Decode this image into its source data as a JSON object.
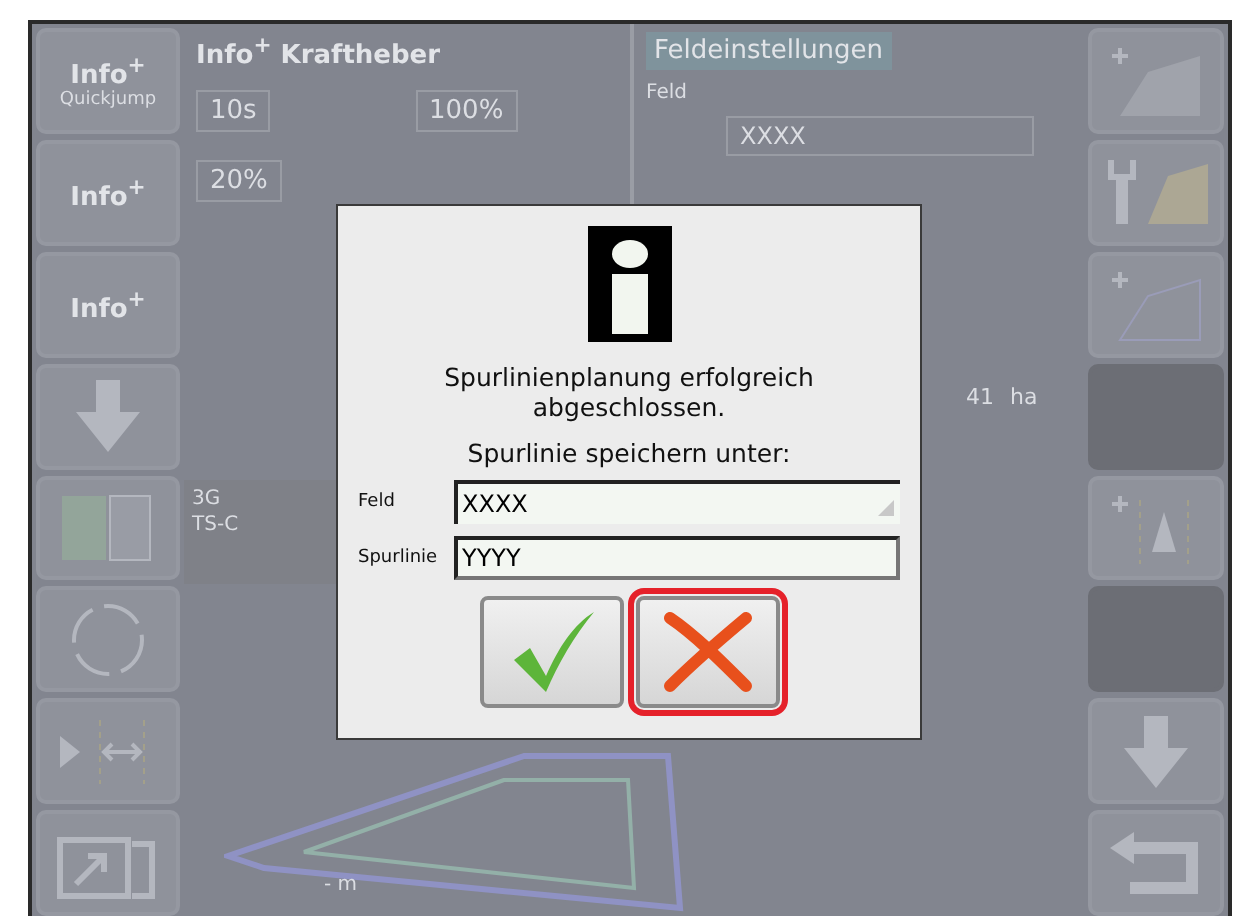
{
  "background": {
    "left_buttons": [
      {
        "kind": "info",
        "label": "Info$^{+}$",
        "caption": "Quickjump"
      },
      {
        "kind": "info",
        "label": "Info$^{+}$"
      },
      {
        "kind": "info",
        "label": "Info$^{+}$"
      },
      {
        "kind": "down"
      },
      {
        "kind": "bars"
      },
      {
        "kind": "ring"
      },
      {
        "kind": "guide"
      },
      {
        "kind": "export"
      }
    ],
    "hitch_panel": {
      "title": "Info$^{+}$ Kraftheber",
      "values": [
        "10s",
        "100%",
        "20%"
      ]
    },
    "field_panel": {
      "title": "Feldeinstellungen",
      "label": "Feld",
      "value": "XXXX",
      "area": "41",
      "unit": "ha"
    },
    "status": {
      "network": "3G",
      "receiver": "TS-C"
    },
    "map": {
      "distance": "- m"
    },
    "right_buttons": [
      {
        "kind": "field-add"
      },
      {
        "kind": "tool"
      },
      {
        "kind": "boundary-add"
      },
      {
        "kind": "blank"
      },
      {
        "kind": "track-add"
      },
      {
        "kind": "blank"
      },
      {
        "kind": "down"
      },
      {
        "kind": "back"
      }
    ]
  },
  "dialog": {
    "message": "Spurlinienplanung erfolgreich abgeschlossen.",
    "prompt": "Spurlinie speichern unter:",
    "fields": [
      {
        "label": "Feld",
        "value": "XXXX",
        "kind": "dropdown"
      },
      {
        "label": "Spurlinie",
        "value": "YYYY",
        "kind": "text"
      }
    ],
    "buttons": [
      {
        "kind": "confirm",
        "selected": false
      },
      {
        "kind": "cancel",
        "selected": true
      }
    ]
  }
}
